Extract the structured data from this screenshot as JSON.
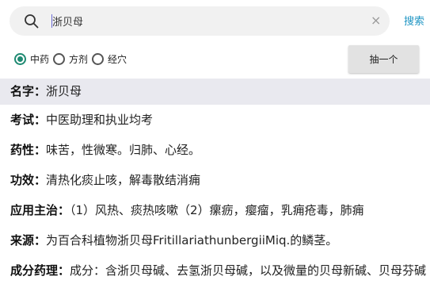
{
  "search": {
    "value": "浙贝母",
    "button_label": "搜索",
    "clear_glyph": "×"
  },
  "filters": {
    "options": [
      {
        "label": "中药",
        "checked": true
      },
      {
        "label": "方剂",
        "checked": false
      },
      {
        "label": "经穴",
        "checked": false
      }
    ],
    "random_button_label": "抽一个"
  },
  "details": [
    {
      "label": "名字：",
      "value": "浙贝母"
    },
    {
      "label": "考试：",
      "value": "中医助理和执业均考"
    },
    {
      "label": "药性：",
      "value": "味苦，性微寒。归肺、心经。"
    },
    {
      "label": "功效：",
      "value": "清热化痰止咳，解毒散结消痈"
    },
    {
      "label": "应用主治：",
      "value": "（1）风热、痰热咳嗽（2）瘰疬，瘿瘤，乳痈疮毒，肺痈"
    },
    {
      "label": "来源：",
      "value": "为百合科植物浙贝母FritillariathunbergiiMiq.的鳞茎。"
    },
    {
      "label": "成分药理：",
      "value": "成分：含浙贝母碱、去氢浙贝母碱，以及微量的贝母新碱、贝母芬碱"
    }
  ],
  "colors": {
    "accent": "#1f8a72",
    "link": "#2196c4",
    "selected_row_bg": "#e9e9ef"
  },
  "icons": {
    "search": "search-icon",
    "clear": "close-icon"
  }
}
